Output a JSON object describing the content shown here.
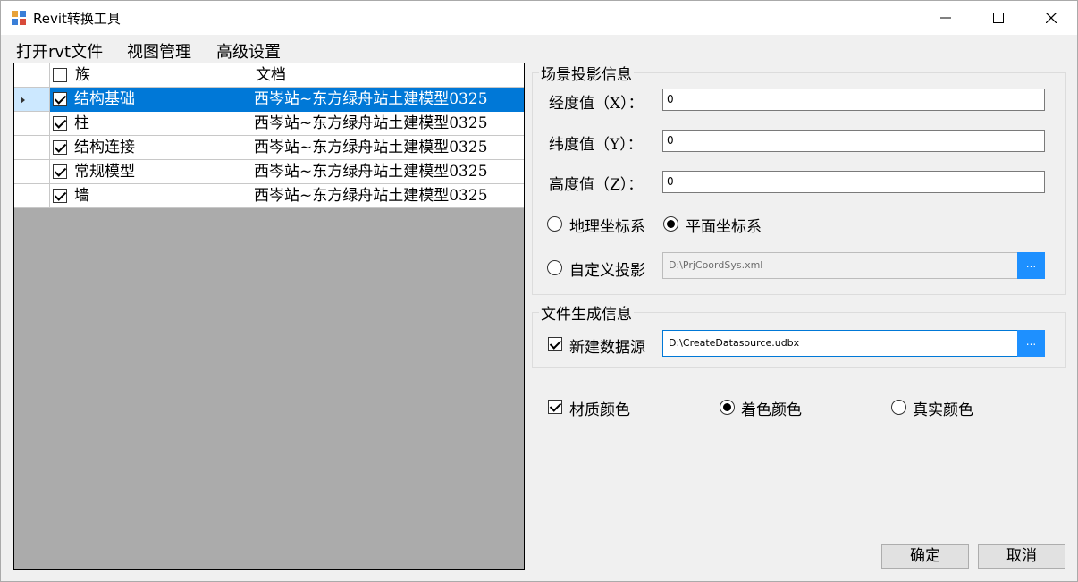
{
  "window": {
    "title": "Revit转换工具"
  },
  "menu": [
    "打开rvt文件",
    "视图管理",
    "高级设置"
  ],
  "grid": {
    "columns": [
      "族",
      "文档"
    ],
    "rows": [
      {
        "family": "结构基础",
        "document": "西岑站~东方绿舟站土建模型0325",
        "checked": true,
        "selected": true
      },
      {
        "family": "柱",
        "document": "西岑站~东方绿舟站土建模型0325",
        "checked": true,
        "selected": false
      },
      {
        "family": "结构连接",
        "document": "西岑站~东方绿舟站土建模型0325",
        "checked": true,
        "selected": false
      },
      {
        "family": "常规模型",
        "document": "西岑站~东方绿舟站土建模型0325",
        "checked": true,
        "selected": false
      },
      {
        "family": "墙",
        "document": "西岑站~东方绿舟站土建模型0325",
        "checked": true,
        "selected": false
      }
    ]
  },
  "projection": {
    "title": "场景投影信息",
    "longitude_label": "经度值（X）：",
    "longitude_value": "0",
    "latitude_label": "纬度值（Y）：",
    "latitude_value": "0",
    "height_label": "高度值（Z）：",
    "height_value": "0",
    "geo_label": "地理坐标系",
    "plane_label": "平面坐标系",
    "custom_label": "自定义投影",
    "custom_path": "D:\\PrjCoordSys.xml",
    "browse": "..."
  },
  "output": {
    "title": "文件生成信息",
    "new_ds_label": "新建数据源",
    "ds_path": "D:\\CreateDatasource.udbx",
    "browse": "..."
  },
  "material": {
    "material_label": "材质颜色",
    "tint_label": "着色颜色",
    "real_label": "真实颜色"
  },
  "buttons": {
    "ok": "确定",
    "cancel": "取消"
  }
}
